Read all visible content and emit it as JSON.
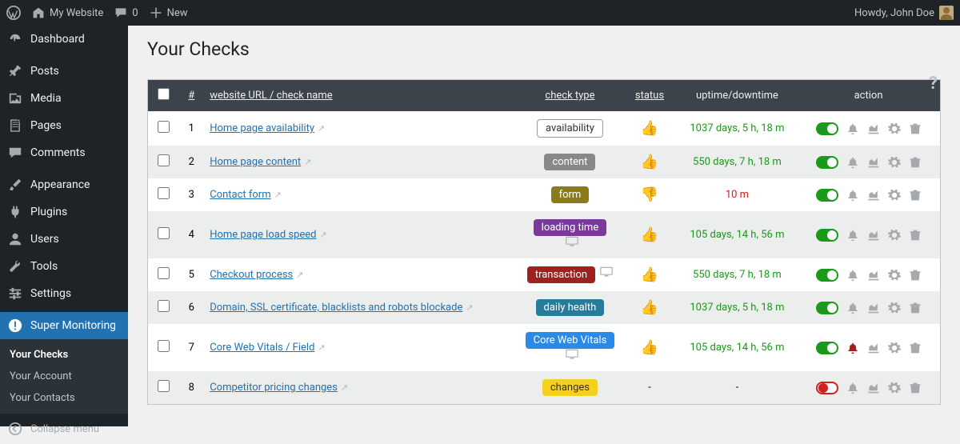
{
  "topbar": {
    "site_name": "My Website",
    "comment_count": "0",
    "new_label": "New",
    "howdy": "Howdy, John Doe"
  },
  "sidebar": {
    "items": [
      {
        "label": "Dashboard",
        "icon": "dashboard"
      },
      {
        "label": "Posts",
        "icon": "pin"
      },
      {
        "label": "Media",
        "icon": "media"
      },
      {
        "label": "Pages",
        "icon": "page"
      },
      {
        "label": "Comments",
        "icon": "comment"
      },
      {
        "label": "Appearance",
        "icon": "brush"
      },
      {
        "label": "Plugins",
        "icon": "plugin"
      },
      {
        "label": "Users",
        "icon": "user"
      },
      {
        "label": "Tools",
        "icon": "wrench"
      },
      {
        "label": "Settings",
        "icon": "sliders"
      },
      {
        "label": "Super Monitoring",
        "icon": "alert",
        "active": true
      }
    ],
    "submenu": [
      {
        "label": "Your Checks",
        "active": true
      },
      {
        "label": "Your Account"
      },
      {
        "label": "Your Contacts"
      }
    ],
    "collapse": "Collapse menu"
  },
  "page": {
    "title": "Your Checks",
    "headers": {
      "number": "#",
      "name": "website URL / check name",
      "type": "check type",
      "status": "status",
      "uptime": "uptime/downtime",
      "action": "action"
    }
  },
  "checks": [
    {
      "num": "1",
      "name": "Home page availability",
      "type_label": "availability",
      "type_class": "availability",
      "status": "up",
      "uptime": "1037 days, 5 h, 18 m",
      "enabled": true,
      "bell": "normal",
      "device": false
    },
    {
      "num": "2",
      "name": "Home page content",
      "type_label": "content",
      "type_class": "content",
      "status": "up",
      "uptime": "550 days, 7 h, 18 m",
      "enabled": true,
      "bell": "normal",
      "device": false
    },
    {
      "num": "3",
      "name": "Contact form",
      "type_label": "form",
      "type_class": "form",
      "status": "down",
      "uptime": "10 m",
      "enabled": true,
      "bell": "normal",
      "device": false
    },
    {
      "num": "4",
      "name": "Home page load speed",
      "type_label": "loading time",
      "type_class": "loading",
      "status": "up",
      "uptime": "105 days, 14 h, 56 m",
      "enabled": true,
      "bell": "normal",
      "device": true
    },
    {
      "num": "5",
      "name": "Checkout process",
      "type_label": "transaction",
      "type_class": "transaction",
      "status": "up",
      "uptime": "550 days, 7 h, 18 m",
      "enabled": true,
      "bell": "normal",
      "device": true
    },
    {
      "num": "6",
      "name": "Domain, SSL certificate, blacklists and robots blockade",
      "type_label": "daily health",
      "type_class": "health",
      "status": "up",
      "uptime": "1037 days, 5 h, 18 m",
      "enabled": true,
      "bell": "normal",
      "device": false
    },
    {
      "num": "7",
      "name": "Core Web Vitals / Field",
      "type_label": "Core Web Vitals",
      "type_class": "cwv",
      "status": "up",
      "uptime": "105 days, 14 h, 56 m",
      "enabled": true,
      "bell": "red",
      "device": true
    },
    {
      "num": "8",
      "name": "Competitor pricing changes",
      "type_label": "changes",
      "type_class": "changes",
      "status": "-",
      "uptime": "-",
      "enabled": false,
      "bell": "normal",
      "device": false
    }
  ]
}
